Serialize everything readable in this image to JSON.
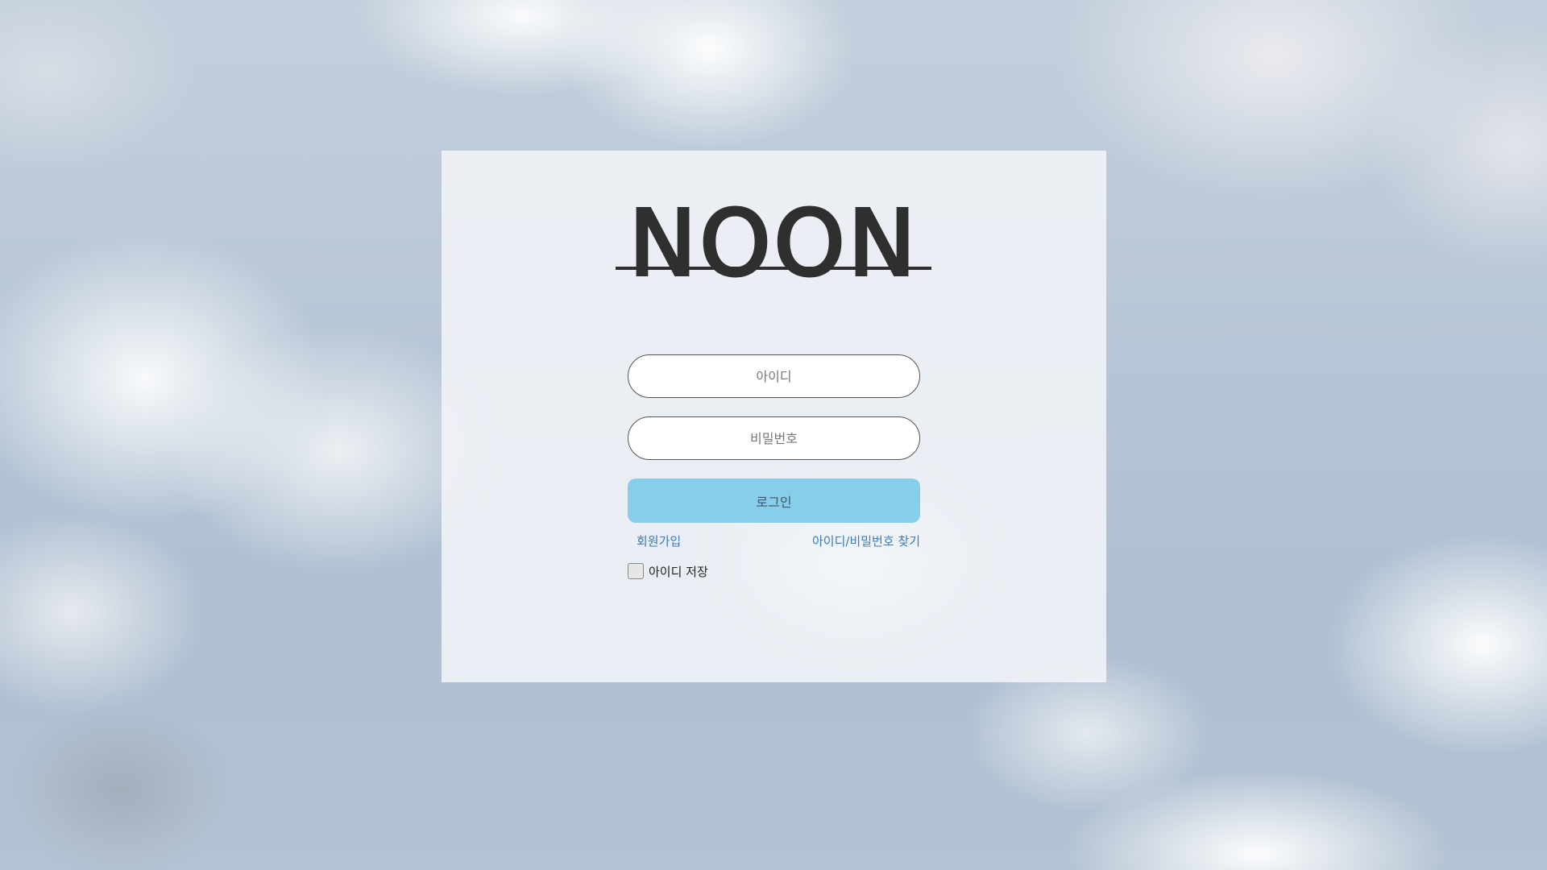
{
  "brand": {
    "logo_text": "NOON"
  },
  "login_form": {
    "id_placeholder": "아이디",
    "id_value": "",
    "password_placeholder": "비밀번호",
    "password_value": "",
    "login_button_label": "로그인",
    "signup_link": "회원가입",
    "find_account_link": "아이디/비밀번호 찾기",
    "remember_id_label": "아이디 저장",
    "remember_id_checked": false
  },
  "colors": {
    "login_button": "#87ceeb",
    "link": "#3a7ab8",
    "logo": "#2f2f2f"
  }
}
